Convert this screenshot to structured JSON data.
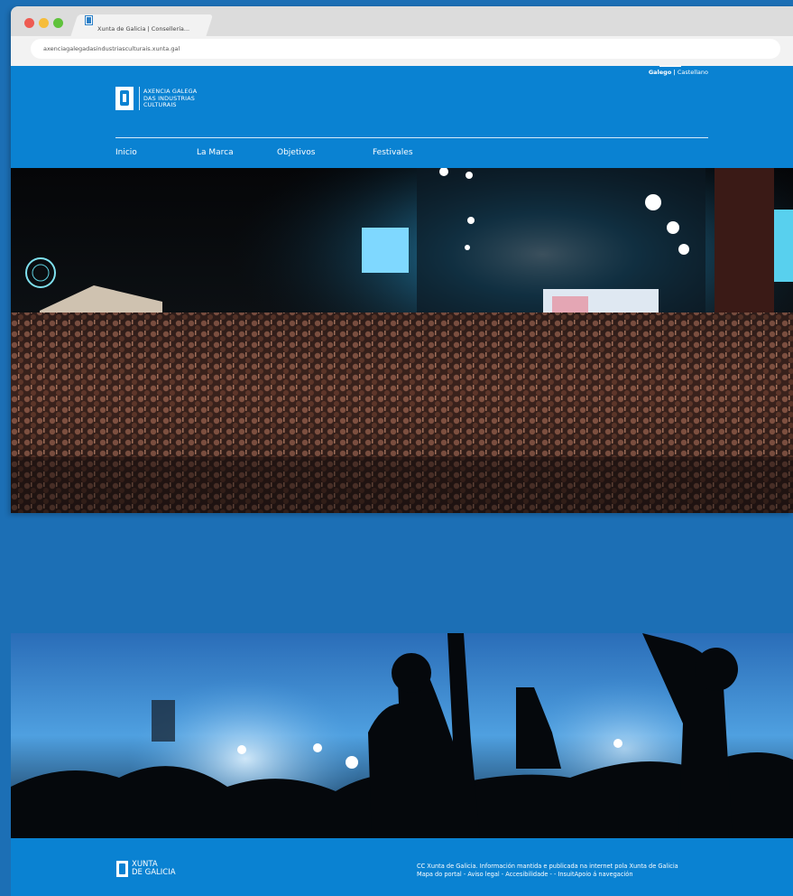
{
  "browser": {
    "tab_title": "Xunta de Galicia | Consellería...",
    "url": "axenciagalegadasindustriasculturais.xunta.gal"
  },
  "header": {
    "lang_active": "Galego",
    "lang_separator": "|",
    "lang_other": "Castellano",
    "logo_lines": [
      "AXENCIA GALEGA",
      "DAS INDUSTRIAS",
      "CULTURAIS"
    ],
    "nav": [
      "Inicio",
      "La Marca",
      "Objetivos",
      "Festivales"
    ]
  },
  "footer": {
    "brand_lines": [
      "XUNTA",
      "DE GALICIA"
    ],
    "line1": "CC Xunta de Galicia. Información mantida e publicada na internet pola Xunta de Galicia",
    "line2": "Mapa do portal - Aviso legal - Accesibilidade -  - InsuitApoio á navegación"
  },
  "colors": {
    "background": "#1c6fb5",
    "brand_blue": "#0a82d2",
    "chrome": "#dcdcdc"
  }
}
